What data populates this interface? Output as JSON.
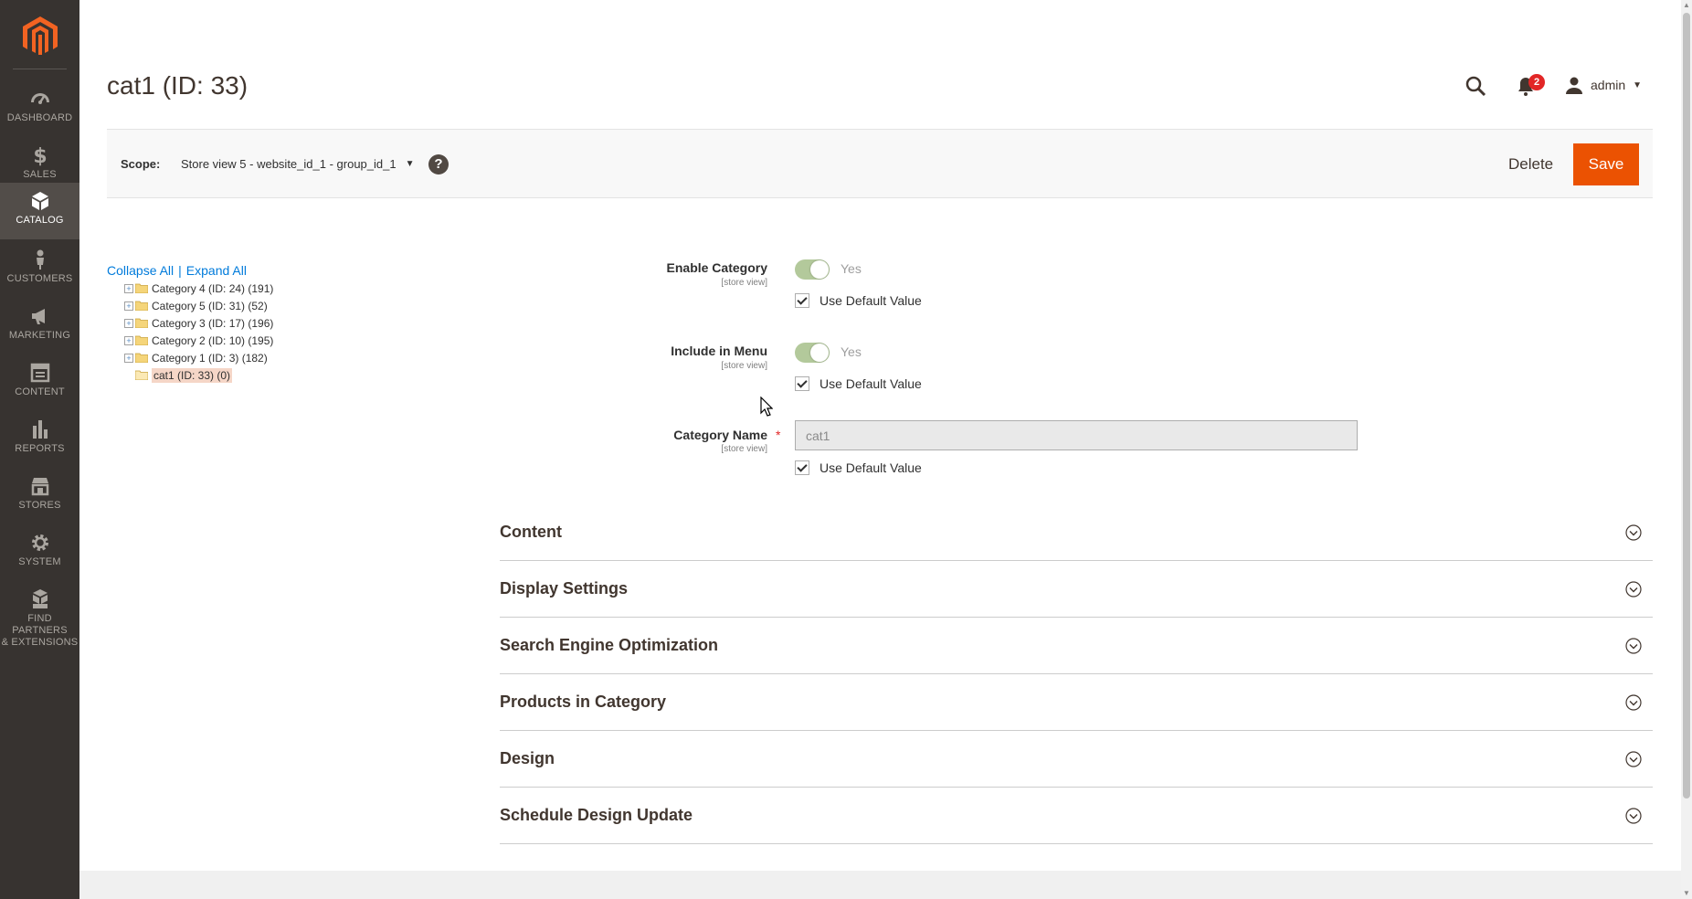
{
  "sidebar": {
    "items": [
      {
        "label": "DASHBOARD",
        "icon": "dashboard-icon"
      },
      {
        "label": "SALES",
        "icon": "dollar-icon"
      },
      {
        "label": "CATALOG",
        "icon": "box-icon"
      },
      {
        "label": "CUSTOMERS",
        "icon": "person-icon"
      },
      {
        "label": "MARKETING",
        "icon": "megaphone-icon"
      },
      {
        "label": "CONTENT",
        "icon": "layout-icon"
      },
      {
        "label": "REPORTS",
        "icon": "bar-chart-icon"
      },
      {
        "label": "STORES",
        "icon": "store-icon"
      },
      {
        "label": "SYSTEM",
        "icon": "gear-icon"
      },
      {
        "label_line1": "FIND PARTNERS",
        "label_line2": "& EXTENSIONS",
        "icon": "cube-stack-icon"
      }
    ],
    "active": "CATALOG"
  },
  "header": {
    "title": "cat1 (ID: 33)",
    "notifications_count": "2",
    "user": "admin"
  },
  "toolbar": {
    "scope_label": "Scope:",
    "scope_value": "Store view 5 - website_id_1 - group_id_1",
    "help": "?",
    "delete_label": "Delete",
    "save_label": "Save"
  },
  "tree": {
    "collapse_all": "Collapse All",
    "separator": "|",
    "expand_all": "Expand All",
    "nodes": [
      "Category 4 (ID: 24) (191)",
      "Category 5 (ID: 31) (52)",
      "Category 3 (ID: 17) (196)",
      "Category 2 (ID: 10) (195)",
      "Category 1 (ID: 3) (182)"
    ],
    "selected": "cat1 (ID: 33) (0)"
  },
  "form": {
    "enable_category": {
      "label": "Enable Category",
      "scope": "[store view]",
      "value": "Yes",
      "use_default": "Use Default Value"
    },
    "include_in_menu": {
      "label": "Include in Menu",
      "scope": "[store view]",
      "value": "Yes",
      "use_default": "Use Default Value"
    },
    "category_name": {
      "label": "Category Name",
      "required": "*",
      "scope": "[store view]",
      "value": "cat1",
      "use_default": "Use Default Value"
    }
  },
  "sections": [
    "Content",
    "Display Settings",
    "Search Engine Optimization",
    "Products in Category",
    "Design",
    "Schedule Design Update"
  ],
  "colors": {
    "sidebar_bg": "#373330",
    "sidebar_active": "#524d49",
    "accent": "#eb5202",
    "link": "#007bdb",
    "badge": "#e22626"
  }
}
